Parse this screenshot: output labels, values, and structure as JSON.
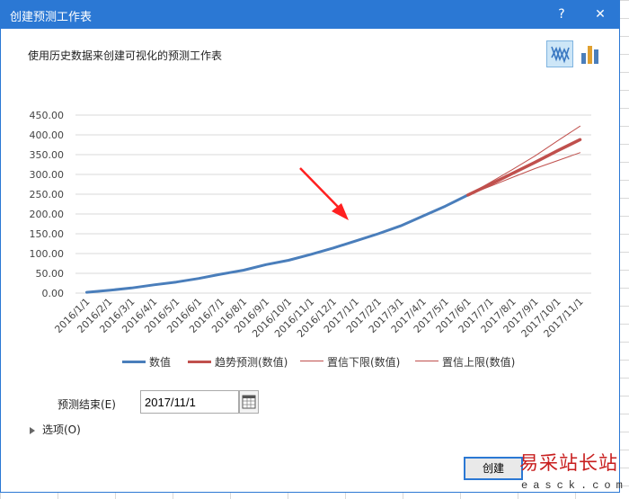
{
  "window": {
    "title": "创建预测工作表",
    "help_label": "?",
    "close_label": "✕"
  },
  "subtitle": "使用历史数据来创建可视化的预测工作表",
  "view_buttons": [
    {
      "name": "line-chart-icon",
      "selected": true
    },
    {
      "name": "column-chart-icon",
      "selected": false
    }
  ],
  "chart_data": {
    "type": "line",
    "ylim": [
      0,
      450
    ],
    "yticks": [
      "0.00",
      "50.00",
      "100.00",
      "150.00",
      "200.00",
      "250.00",
      "300.00",
      "350.00",
      "400.00",
      "450.00"
    ],
    "categories": [
      "2016/1/1",
      "2016/2/1",
      "2016/3/1",
      "2016/4/1",
      "2016/5/1",
      "2016/6/1",
      "2016/7/1",
      "2016/8/1",
      "2016/9/1",
      "2016/10/1",
      "2016/11/1",
      "2016/12/1",
      "2017/1/1",
      "2017/2/1",
      "2017/3/1",
      "2017/4/1",
      "2017/5/1",
      "2017/6/1",
      "2017/7/1",
      "2017/8/1",
      "2017/9/1",
      "2017/10/1",
      "2017/11/1"
    ],
    "grid": true,
    "legend_position": "bottom",
    "series": [
      {
        "name": "数值",
        "color": "#4a7ebb",
        "start_index": 0,
        "values": [
          2,
          7,
          13,
          21,
          28,
          37,
          48,
          58,
          72,
          83,
          98,
          114,
          132,
          150,
          170,
          195,
          220,
          248
        ]
      },
      {
        "name": "趋势预测(数值)",
        "color": "#c0504d",
        "start_index": 17,
        "values": [
          248,
          275,
          303,
          331,
          360,
          388
        ]
      },
      {
        "name": "置信下限(数值)",
        "color": "#c0504d",
        "start_index": 17,
        "values": [
          248,
          270,
          293,
          315,
          335,
          355
        ]
      },
      {
        "name": "置信上限(数值)",
        "color": "#c0504d",
        "start_index": 17,
        "values": [
          248,
          280,
          313,
          347,
          385,
          422
        ]
      }
    ]
  },
  "forecast_end": {
    "label": "预测结束(E)",
    "value": "2017/11/1"
  },
  "options_label": "选项(O)",
  "create_label": "创建",
  "watermark": {
    "main": "易采站长站",
    "sub": "easck.com"
  }
}
